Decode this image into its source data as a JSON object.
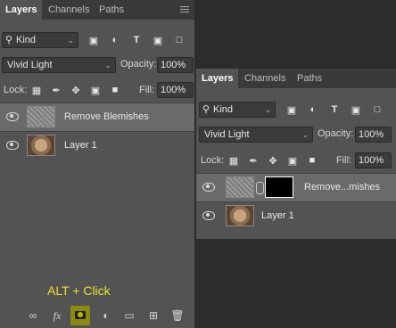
{
  "left_panel": {
    "tabs": [
      {
        "label": "Layers"
      },
      {
        "label": "Channels"
      },
      {
        "label": "Paths"
      }
    ],
    "filter": {
      "value": "Kind"
    },
    "blend_mode": {
      "value": "Vivid Light"
    },
    "opacity": {
      "label": "Opacity:",
      "value": "100%"
    },
    "lock": {
      "label": "Lock:"
    },
    "fill": {
      "label": "Fill:",
      "value": "100%"
    },
    "layers": [
      {
        "name": "Remove Blemishes",
        "selected": true
      },
      {
        "name": "Layer 1",
        "selected": false
      }
    ],
    "annotation": "ALT + Click"
  },
  "right_panel": {
    "tabs": [
      {
        "label": "Layers"
      },
      {
        "label": "Channels"
      },
      {
        "label": "Paths"
      }
    ],
    "filter": {
      "value": "Kind"
    },
    "blend_mode": {
      "value": "Vivid Light"
    },
    "opacity": {
      "label": "Opacity:",
      "value": "100%"
    },
    "lock": {
      "label": "Lock:"
    },
    "fill": {
      "label": "Fill:",
      "value": "100%"
    },
    "layers": [
      {
        "name": "Remove...mishes",
        "selected": true
      },
      {
        "name": "Layer 1",
        "selected": false
      }
    ]
  },
  "colors": {
    "panel": "#535353",
    "selected": "#6a6a6a",
    "annotation": "#e8e22e",
    "highlight": "#8a8a0e"
  }
}
